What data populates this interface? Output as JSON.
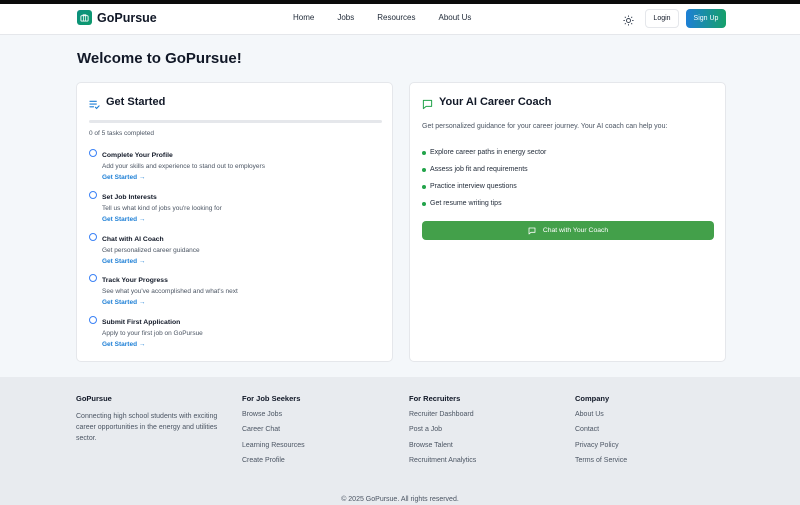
{
  "header": {
    "brand": "GoPursue",
    "nav": [
      "Home",
      "Jobs",
      "Resources",
      "About Us"
    ],
    "login_label": "Login",
    "signup_label": "Sign Up"
  },
  "page_title": "Welcome to GoPursue!",
  "get_started": {
    "title": "Get Started",
    "progress_text": "0 of 5 tasks completed",
    "progress_fraction": 0,
    "tasks": [
      {
        "title": "Complete Your Profile",
        "desc": "Add your skills and experience to stand out to employers",
        "link": "Get Started →"
      },
      {
        "title": "Set Job Interests",
        "desc": "Tell us what kind of jobs you're looking for",
        "link": "Get Started →"
      },
      {
        "title": "Chat with AI Coach",
        "desc": "Get personalized career guidance",
        "link": "Get Started →"
      },
      {
        "title": "Track Your Progress",
        "desc": "See what you've accomplished and what's next",
        "link": "Get Started →"
      },
      {
        "title": "Submit First Application",
        "desc": "Apply to your first job on GoPursue",
        "link": "Get Started →"
      }
    ]
  },
  "coach": {
    "title": "Your AI Career Coach",
    "intro": "Get personalized guidance for your career journey. Your AI coach can help you:",
    "bullets": [
      "Explore career paths in energy sector",
      "Assess job fit and requirements",
      "Practice interview questions",
      "Get resume writing tips"
    ],
    "button_label": "Chat with Your Coach"
  },
  "footer": {
    "brand": "GoPursue",
    "description": "Connecting high school students with exciting career opportunities in the energy and utilities sector.",
    "columns": [
      {
        "title": "For Job Seekers",
        "links": [
          "Browse Jobs",
          "Career Chat",
          "Learning Resources",
          "Create Profile"
        ]
      },
      {
        "title": "For Recruiters",
        "links": [
          "Recruiter Dashboard",
          "Post a Job",
          "Browse Talent",
          "Recruitment Analytics"
        ]
      },
      {
        "title": "Company",
        "links": [
          "About Us",
          "Contact",
          "Privacy Policy",
          "Terms of Service"
        ]
      }
    ],
    "copyright": "© 2025 GoPursue. All rights reserved."
  },
  "colors": {
    "accent_blue": "#1d7fd6",
    "accent_green": "#43a04a",
    "brand_teal": "#0c8f7f"
  }
}
